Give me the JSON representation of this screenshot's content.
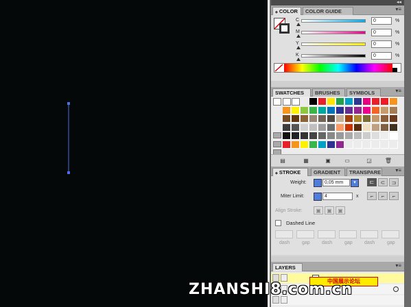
{
  "dock": {
    "collapse_icon": "double-chevron-right"
  },
  "color_panel": {
    "tabs": [
      {
        "label": "COLOR",
        "active": true
      },
      {
        "label": "COLOR GUIDE",
        "active": false
      }
    ],
    "menu_icon": "▾≡",
    "channels": [
      {
        "label": "C",
        "value": "0",
        "unit": "%",
        "gradient": [
          "#ffffff",
          "#00aeef"
        ]
      },
      {
        "label": "M",
        "value": "0",
        "unit": "%",
        "gradient": [
          "#ffffff",
          "#ec008c"
        ]
      },
      {
        "label": "Y",
        "value": "0",
        "unit": "%",
        "gradient": [
          "#ffffff",
          "#fff200"
        ]
      },
      {
        "label": "K",
        "value": "0",
        "unit": "%",
        "gradient": [
          "#ffffff",
          "#000000"
        ]
      }
    ]
  },
  "swatches_panel": {
    "tabs": [
      {
        "label": "SWATCHES",
        "active": true
      },
      {
        "label": "BRUSHES",
        "active": false
      },
      {
        "label": "SYMBOLS",
        "active": false
      }
    ],
    "menu_icon": "▾≡"
  },
  "stroke_panel": {
    "tabs": [
      {
        "label": "STROKE",
        "active": true
      },
      {
        "label": "GRADIENT",
        "active": false
      },
      {
        "label": "TRANSPARE",
        "active": false
      }
    ],
    "menu_icon": "▾≡",
    "weight_label": "Weight:",
    "weight_value": "0,05 mm",
    "miter_label": "Miter Limit:",
    "miter_value": "4",
    "miter_unit": "x",
    "align_label": "Align Stroke:",
    "dashed_label": "Dashed Line",
    "dash_labels": [
      "dash",
      "gap",
      "dash",
      "gap",
      "dash",
      "gap"
    ]
  },
  "layers_panel": {
    "tabs": [
      {
        "label": "LAYERS",
        "active": true
      }
    ],
    "menu_icon": "▾≡"
  },
  "watermark": {
    "text": "ZHANSHI8.com.cn",
    "stamp_text": "中国展示论坛"
  },
  "colors": {
    "artboard": "#050808",
    "path": "#4a6fe0",
    "panel_bg": "#e0e0e0"
  }
}
